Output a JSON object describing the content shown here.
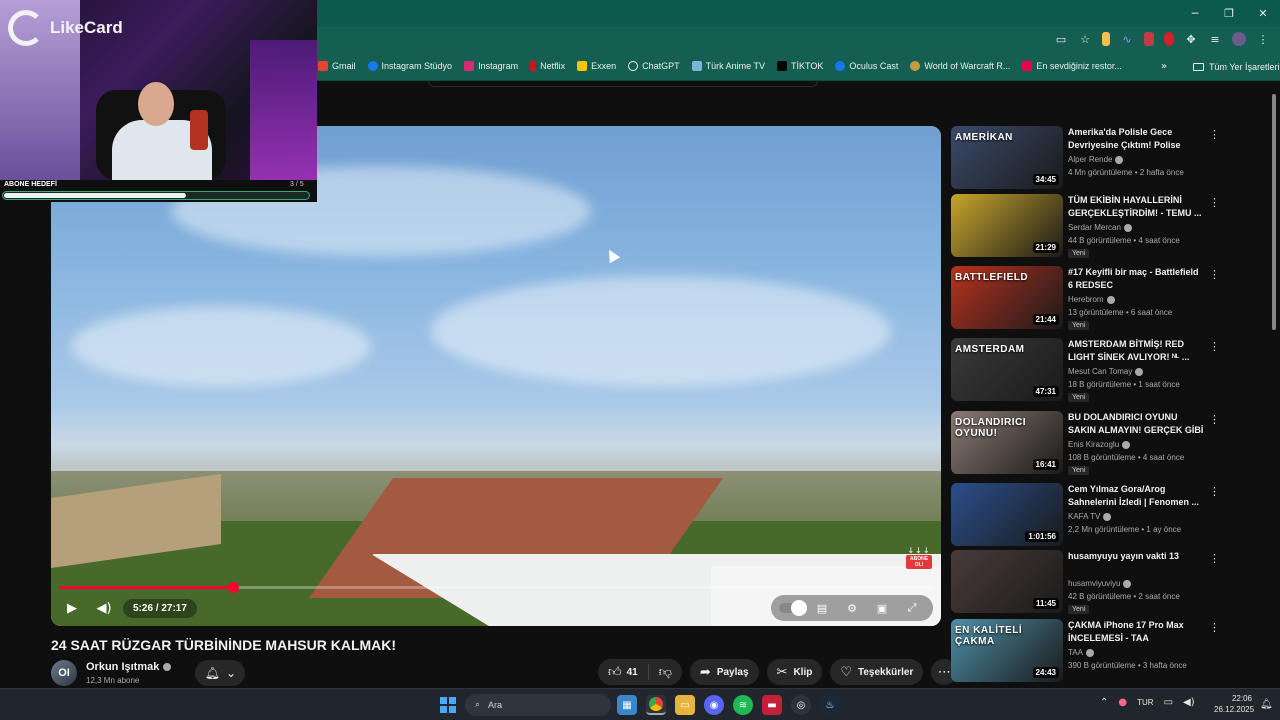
{
  "browser": {
    "bookmarks": [
      "Gmail",
      "Instagram Stüdyo",
      "Instagram",
      "Netflix",
      "Exxen",
      "ChatGPT",
      "Türk Anime TV",
      "TİKTOK",
      "Oculus Cast",
      "World of Warcraft R...",
      "En sevdiğiniz restor..."
    ],
    "all_bookmarks": "Tüm Yer İşaretleri",
    "more": "»"
  },
  "overlay": {
    "logo": "LikeCard",
    "goal_label": "ABONE HEDEFİ",
    "goal_count": "3 / 5",
    "goal_progress": 0.6
  },
  "player": {
    "time": "5:26 / 27:17",
    "progress": 0.199,
    "abone_badge": "ABONE OL!"
  },
  "video": {
    "title": "24 SAAT RÜZGAR TÜRBİNİNDE MAHSUR KALMAK!",
    "channel": "Orkun Işıtmak",
    "subscribers": "12,3 Mn abone",
    "like_count": "41",
    "share": "Paylaş",
    "clip": "Klip",
    "thanks": "Teşekkürler"
  },
  "recommendations": [
    {
      "title": "Amerika'da Polisle Gece Devriyesine Çıktım! Polise Küf...",
      "channel": "Alper Rende",
      "meta": "4 Mn görüntüleme • 2 hafta önce",
      "duration": "34:45",
      "thumb_text": "AMERİKAN",
      "new": "",
      "color": "#3b4a6b"
    },
    {
      "title": "TÜM EKİBİN HAYALLERİNİ GERÇEKLEŞTİRDİM! - TEMU ...",
      "channel": "Serdar Mercan",
      "meta": "44 B görüntüleme • 4 saat önce",
      "duration": "21:29",
      "thumb_text": "",
      "new": "Yeni",
      "color": "#c7a52c"
    },
    {
      "title": "#17 Keyifli bir maç - Battlefield 6 REDSEC",
      "channel": "Herebrom",
      "meta": "13 görüntüleme • 6 saat önce",
      "duration": "21:44",
      "thumb_text": "BATTLEFIELD",
      "new": "Yeni",
      "color": "#b8321e"
    },
    {
      "title": "AMSTERDAM BİTMİŞ! RED LIGHT SİNEK AVLIYOR! ᴺᴸ ...",
      "channel": "Mesut Can Tomay",
      "meta": "18 B görüntüleme • 1 saat önce",
      "duration": "47:31",
      "thumb_text": "AMSTERDAM",
      "new": "Yeni",
      "color": "#3a3a3a"
    },
    {
      "title": "BU DOLANDIRICI OYUNU SAKIN ALMAYIN! GERÇEK GİBİ ...",
      "channel": "Enis Kirazoglu",
      "meta": "108 B görüntüleme • 4 saat önce",
      "duration": "16:41",
      "thumb_text": "DOLANDIRICI OYUNU!",
      "new": "Yeni",
      "color": "#8a7a72"
    },
    {
      "title": "Cem Yılmaz Gora/Arog Sahnelerini İzledi | Fenomen ...",
      "channel": "KAFA TV",
      "meta": "2,2 Mn görüntüleme • 1 ay önce",
      "duration": "1:01:56",
      "thumb_text": "",
      "new": "",
      "color": "#2a4f8c"
    },
    {
      "title": "husamyuyu yayın vakti 13",
      "channel": "husamviyuviyu",
      "meta": "42 B görüntüleme • 2 saat önce",
      "duration": "11:45",
      "thumb_text": "",
      "new": "Yeni",
      "color": "#4a3b3b"
    },
    {
      "title": "ÇAKMA iPhone 17 Pro Max İNCELEMESİ - TAA",
      "channel": "TAA",
      "meta": "390 B görüntüleme • 3 hafta önce",
      "duration": "24:43",
      "thumb_text": "EN KALİTELİ ÇAKMA",
      "new": "",
      "color": "#4e8fa8"
    }
  ],
  "taskbar": {
    "search": "Ara",
    "language": "TUR",
    "time": "22:06",
    "date": "26.12.2025"
  }
}
